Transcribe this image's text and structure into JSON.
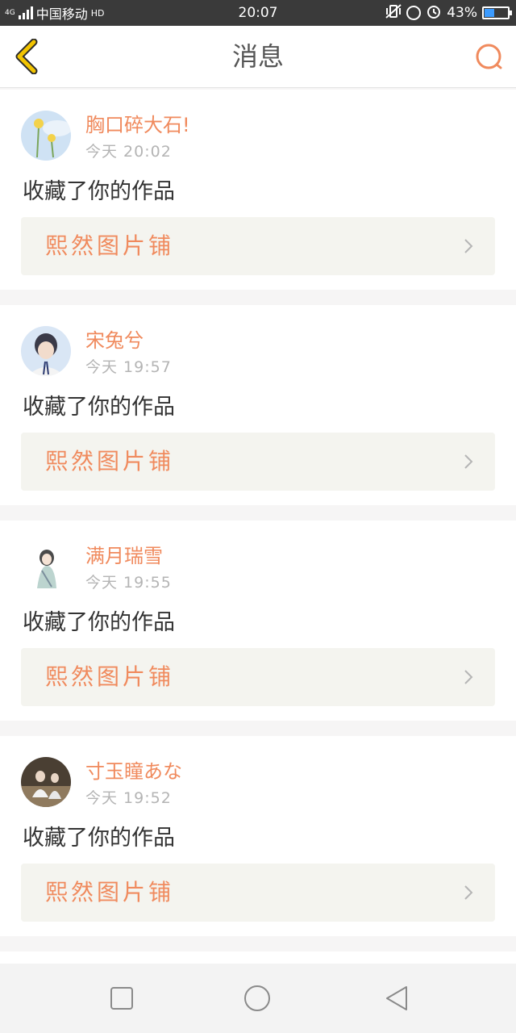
{
  "status_bar": {
    "network": "4G",
    "carrier": "中国移动",
    "hd": "HD",
    "time": "20:07",
    "battery": "43%",
    "battery_level": 0.43,
    "icons": [
      "signal-icon",
      "vibrate-icon",
      "rotation-lock-icon",
      "alarm-icon",
      "battery-icon"
    ]
  },
  "header": {
    "title": "消息",
    "back_icon": "chevron-left-icon",
    "search_icon": "search-icon"
  },
  "colors": {
    "accent": "#f08a5d",
    "back_arrow": "#f2c400",
    "card_bg": "#ffffff",
    "page_bg": "#f6f5f5",
    "work_bg": "#f4f4ef"
  },
  "messages": [
    {
      "name": "胸口碎大石!",
      "time": "今天  20:02",
      "action": "收藏了你的作品",
      "work": "熙然图片铺"
    },
    {
      "name": "宋兔兮",
      "time": "今天  19:57",
      "action": "收藏了你的作品",
      "work": "熙然图片铺"
    },
    {
      "name": "满月瑞雪",
      "time": "今天  19:55",
      "action": "收藏了你的作品",
      "work": "熙然图片铺"
    },
    {
      "name": "寸玉瞳あな",
      "time": "今天  19:52",
      "action": "收藏了你的作品",
      "work": "熙然图片铺"
    }
  ],
  "nav_bar": {
    "icons": [
      "recent-apps-icon",
      "home-icon",
      "back-triangle-icon"
    ]
  }
}
